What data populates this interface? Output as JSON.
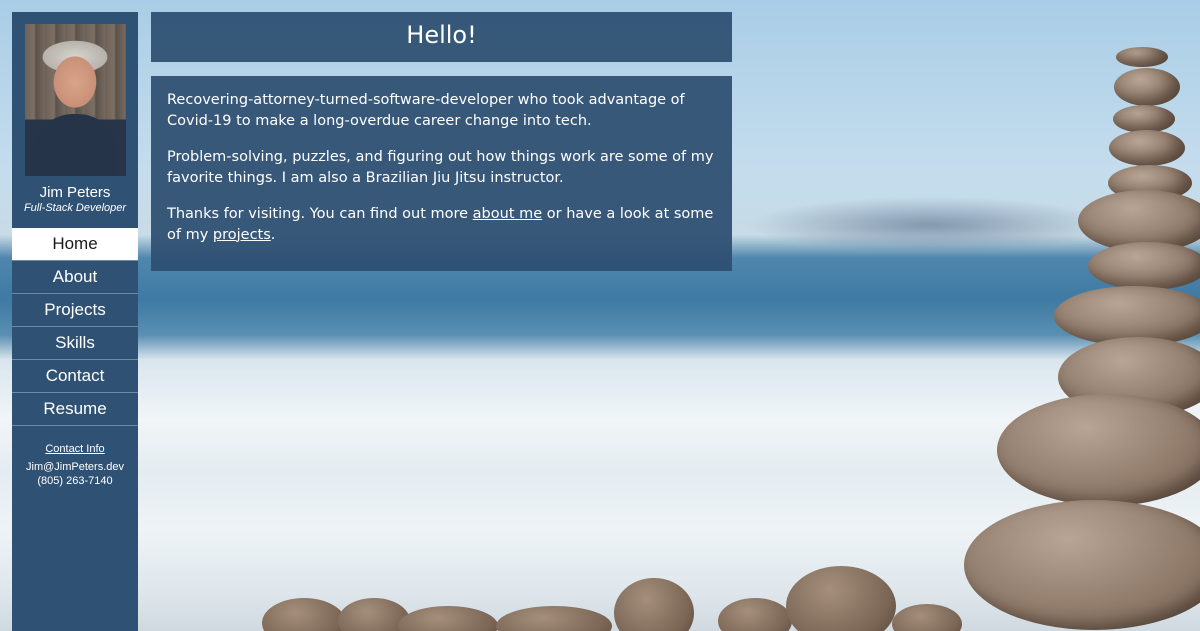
{
  "sidebar": {
    "name": "Jim Peters",
    "title": "Full-Stack Developer",
    "nav": [
      {
        "label": "Home",
        "active": true
      },
      {
        "label": "About",
        "active": false
      },
      {
        "label": "Projects",
        "active": false
      },
      {
        "label": "Skills",
        "active": false
      },
      {
        "label": "Contact",
        "active": false
      },
      {
        "label": "Resume",
        "active": false
      }
    ],
    "contact": {
      "heading": "Contact Info",
      "email": "Jim@JimPeters.dev",
      "phone": "(805) 263-7140"
    }
  },
  "main": {
    "heading": "Hello!",
    "para1": "Recovering-attorney-turned-software-developer who took advantage of Covid-19 to make a long-overdue career change into tech.",
    "para2": "Problem-solving, puzzles, and figuring out how things work are some of my favorite things. I am also a Brazilian Jiu Jitsu instructor.",
    "para3_before": "Thanks for visiting. You can find out more ",
    "para3_link1": "about me",
    "para3_middle": " or have a look at some of my ",
    "para3_link2": "projects",
    "para3_after": "."
  },
  "colors": {
    "panel": "#2f5274",
    "active_nav_bg": "#ffffff",
    "text": "#ffffff"
  }
}
